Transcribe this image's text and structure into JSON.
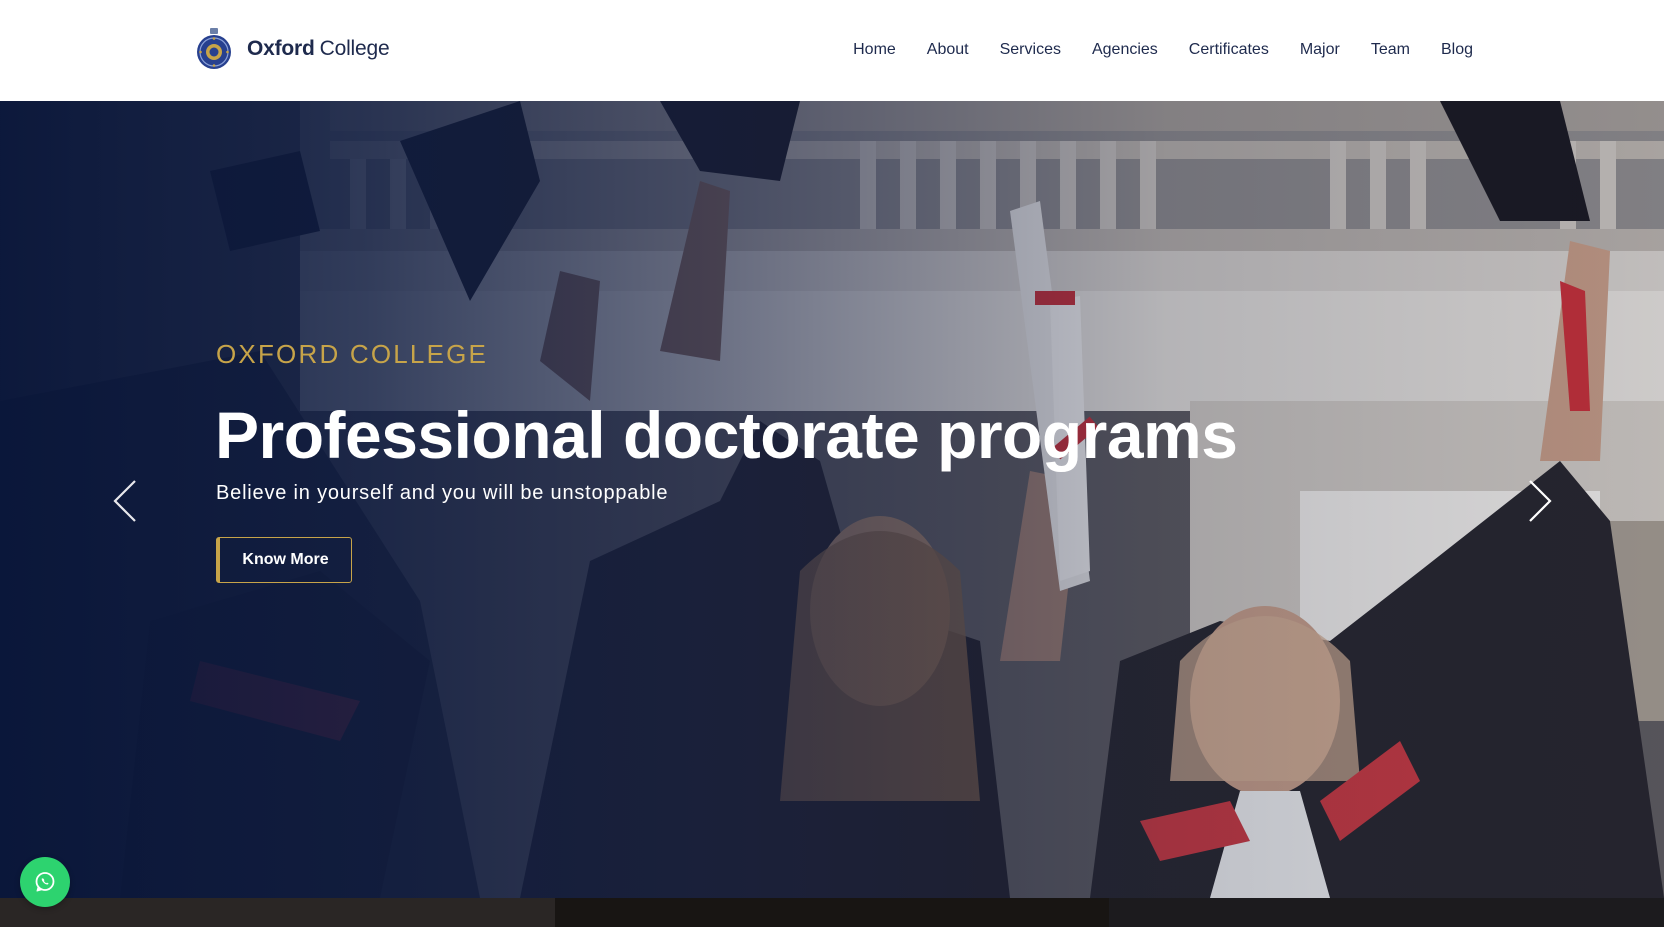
{
  "brand": {
    "name_bold": "Oxford",
    "name_light": "College"
  },
  "nav": {
    "items": [
      {
        "label": "Home"
      },
      {
        "label": "About"
      },
      {
        "label": "Services"
      },
      {
        "label": "Agencies"
      },
      {
        "label": "Certificates"
      },
      {
        "label": "Major"
      },
      {
        "label": "Team"
      },
      {
        "label": "Blog"
      }
    ]
  },
  "hero": {
    "eyebrow": "OXFORD COLLEGE",
    "headline": "Professional doctorate programs",
    "tagline": "Believe in yourself and you will be unstoppable",
    "cta_label": "Know More"
  },
  "icons": {
    "logo": "college-crest-icon",
    "prev": "chevron-left-icon",
    "next": "chevron-right-icon",
    "chat": "whatsapp-icon"
  },
  "colors": {
    "brand_navy": "#1e2a4d",
    "accent_gold": "#c7a449",
    "whatsapp_green": "#2dd36f"
  }
}
